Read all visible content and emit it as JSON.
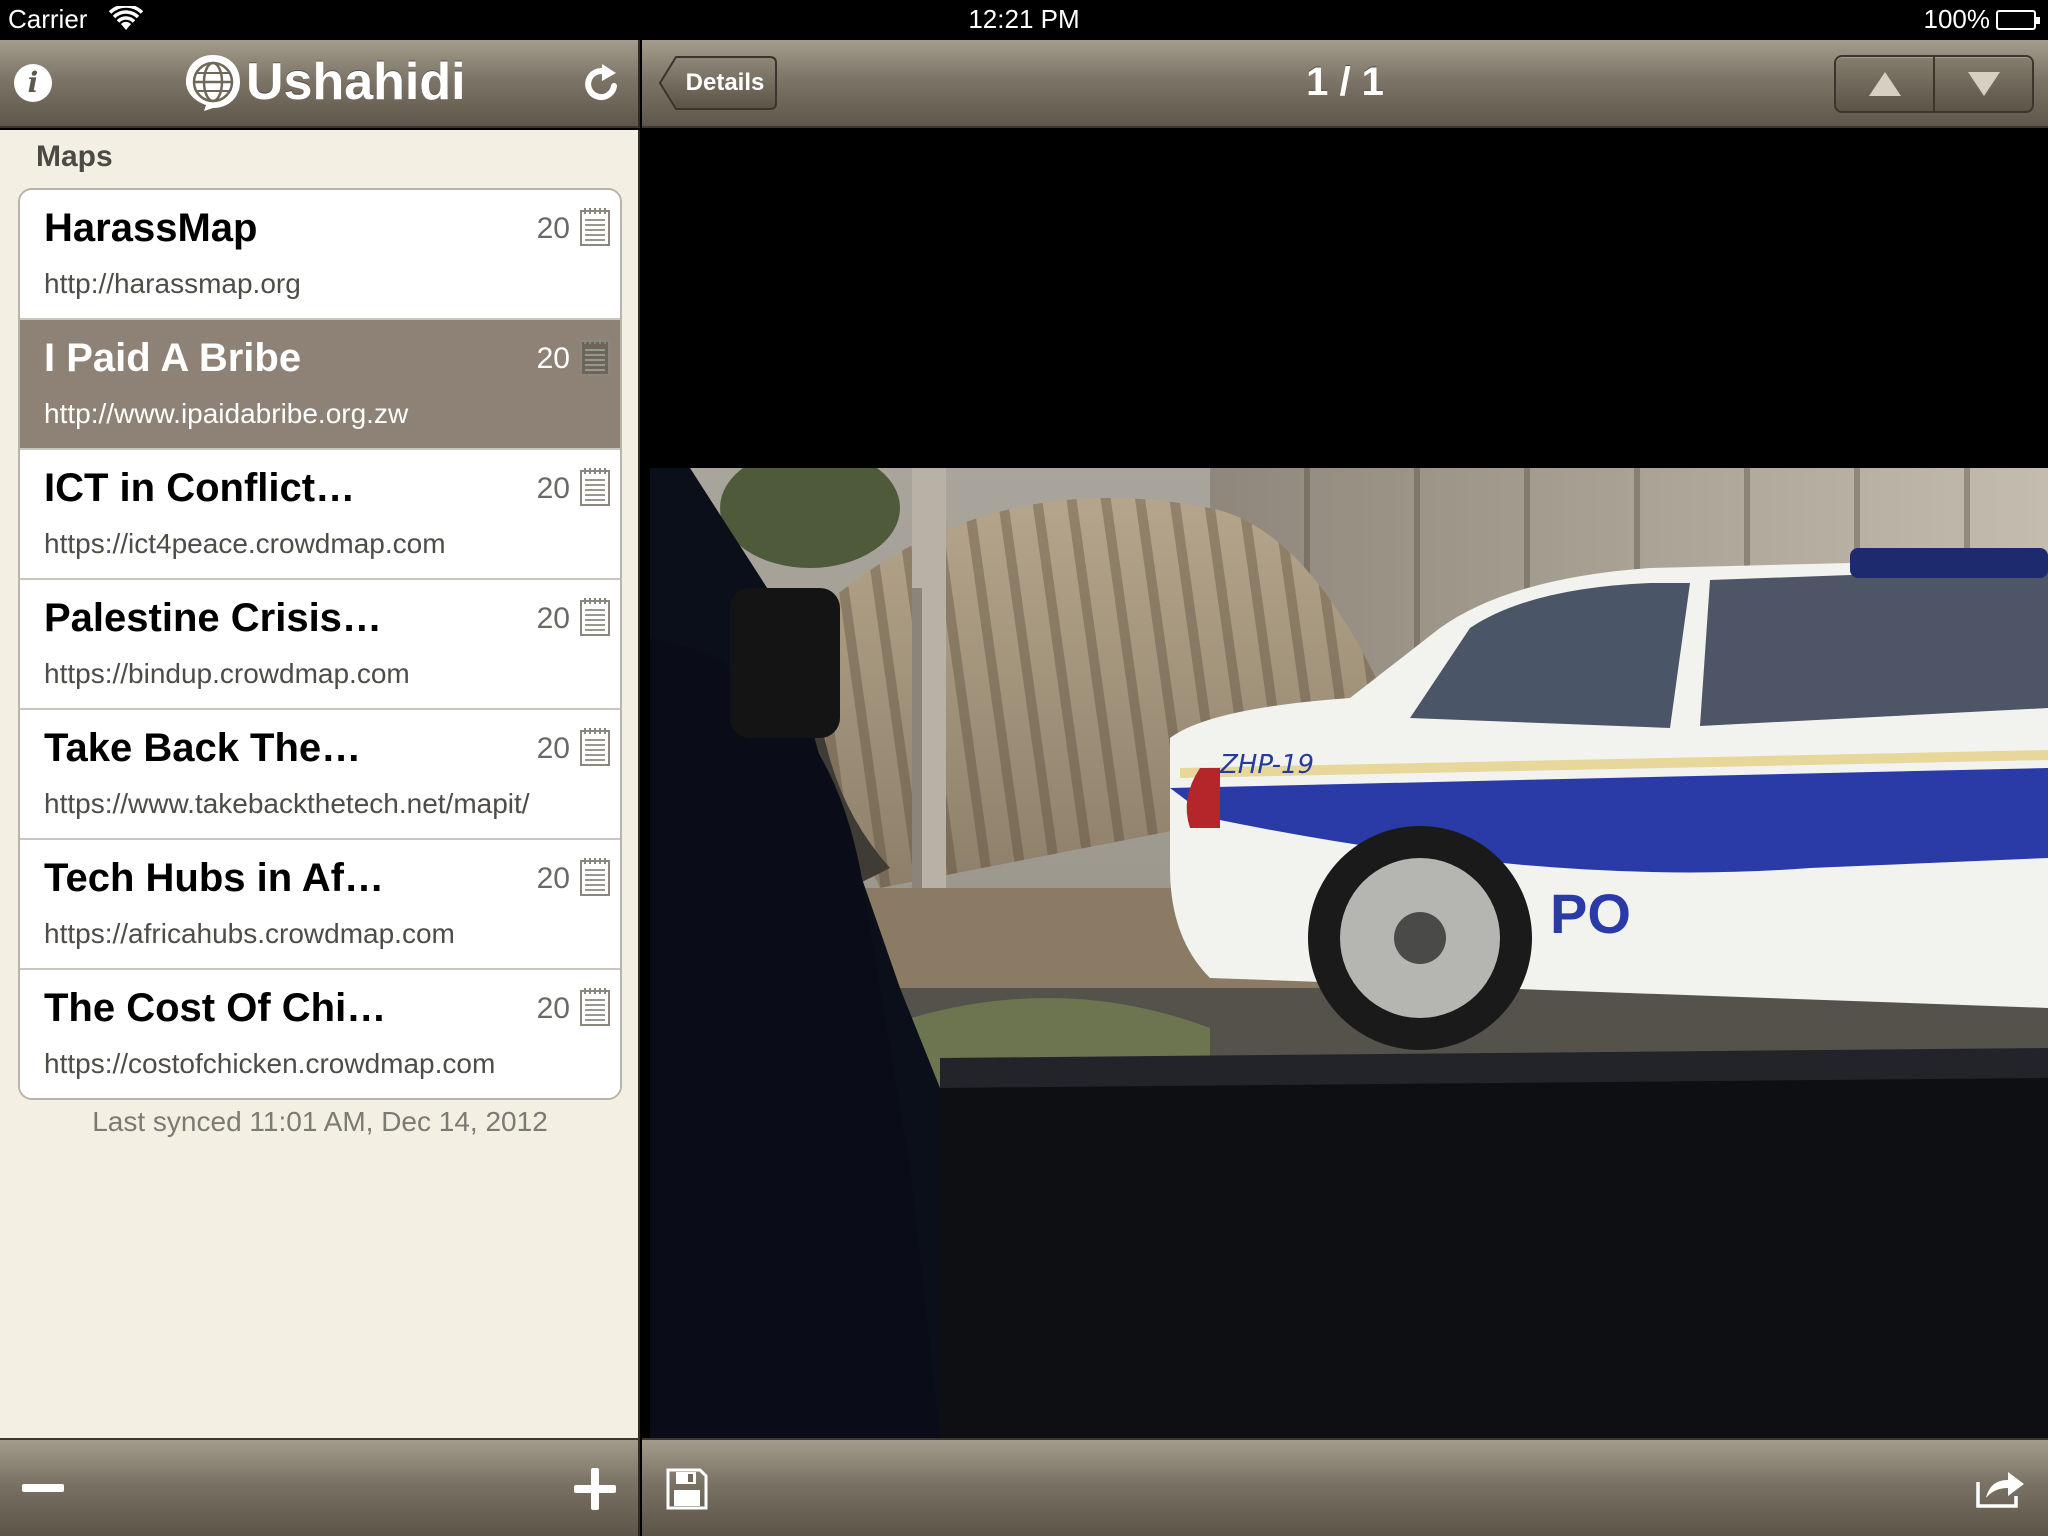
{
  "status_bar": {
    "carrier": "Carrier",
    "time": "12:21 PM",
    "battery": "100%"
  },
  "left_nav": {
    "info_icon": "i",
    "app_name": "Ushahidi",
    "refresh_icon": "refresh-icon"
  },
  "right_nav": {
    "back_label": "Details",
    "title": "1 / 1",
    "prev_icon": "up-arrow-icon",
    "next_icon": "down-arrow-icon"
  },
  "maps": {
    "header": "Maps",
    "items": [
      {
        "name": "HarassMap",
        "url": "http://harassmap.org",
        "count": "20",
        "selected": false
      },
      {
        "name": "I Paid A Bribe",
        "url": "http://www.ipaidabribe.org.zw",
        "count": "20",
        "selected": true
      },
      {
        "name": "ICT in Conflict…",
        "url": "https://ict4peace.crowdmap.com",
        "count": "20",
        "selected": false
      },
      {
        "name": "Palestine Crisis…",
        "url": "https://bindup.crowdmap.com",
        "count": "20",
        "selected": false
      },
      {
        "name": "Take Back The…",
        "url": "https://www.takebackthetech.net/mapit/",
        "count": "20",
        "selected": false
      },
      {
        "name": "Tech Hubs in Af…",
        "url": "https://africahubs.crowdmap.com",
        "count": "20",
        "selected": false
      },
      {
        "name": "The Cost Of Chi…",
        "url": "https://costofchicken.crowdmap.com",
        "count": "20",
        "selected": false
      }
    ],
    "last_synced": "Last synced 11:01 AM, Dec 14, 2012"
  },
  "photo": {
    "car_label": "ZHP-19",
    "door_text": "PO"
  },
  "toolbar": {
    "remove_icon": "minus-icon",
    "add_icon": "plus-icon",
    "save_icon": "floppy-disk-icon",
    "share_icon": "share-icon"
  },
  "colors": {
    "bar_top": "#a49d8d",
    "bar_bottom": "#5e574b",
    "panel_bg": "#f3efe3",
    "selected_row": "#8d8275"
  }
}
